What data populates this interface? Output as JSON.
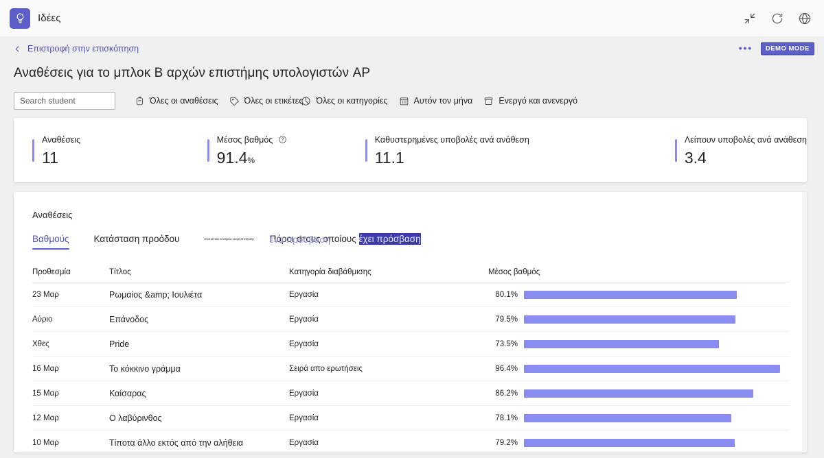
{
  "appbar": {
    "title": "Ιδέες",
    "logo_icon": "lightbulb-icon",
    "icons": [
      {
        "name": "collapse-icon",
        "label": "Collapse"
      },
      {
        "name": "refresh-icon",
        "label": "Refresh"
      },
      {
        "name": "globe-icon",
        "label": "Language"
      }
    ]
  },
  "breadcrumb": {
    "back_label": "Επιστροφή στην επισκόπηση",
    "more_label": "•••",
    "demo_badge": "DEMO MODE"
  },
  "page": {
    "title": "Αναθέσεις για το μπλοκ Β αρχών επιστήμης υπολογιστών AP"
  },
  "toolbar": {
    "search_placeholder": "Search student",
    "search_value": "",
    "filters": [
      {
        "label": "Όλες οι αναθέσεις",
        "icon": "backpack-icon"
      },
      {
        "label": "Όλες οι ετικέτες",
        "icon": "tag-icon"
      },
      {
        "label": "Όλες οι κατηγορίες",
        "icon": "pie-chart-icon"
      },
      {
        "label": "Αυτόν τον μήνα",
        "icon": "calendar-icon"
      },
      {
        "label": "Ενεργό και ανενεργό",
        "icon": "archive-icon"
      }
    ]
  },
  "stats": [
    {
      "label": "Αναθέσεις",
      "value": "11",
      "unit": "",
      "has_info": false
    },
    {
      "label": "Μέσος βαθμός",
      "value": "91.4",
      "unit": "%",
      "has_info": true
    },
    {
      "label": "Καθυστερημένες υποβολές ανά ανάθεση",
      "value": "11.1",
      "unit": "",
      "has_info": false
    },
    {
      "label": "Λείπουν υποβολές ανά ανάθεση",
      "value": "3.4",
      "unit": "",
      "has_info": false
    }
  ],
  "panel": {
    "title": "Αναθέσεις",
    "tabs": [
      {
        "label": "Βαθμούς",
        "active": true,
        "tiny": false
      },
      {
        "label": "Κατάσταση προόδου",
        "active": false,
        "tiny": false
      },
      {
        "label": "Στατιστικά στοιχεία ενεργοποίησης",
        "active": false,
        "tiny": true
      },
      {
        "label": "Πόροι στους οποίους ",
        "active": false,
        "tiny": false
      }
    ],
    "selected_text": "έχει πρόσβαση",
    "selected_overlay": "ένα πρόσβαση"
  },
  "table": {
    "columns": [
      "Προθεσμία",
      "Τίτλος",
      "Κατηγορία διαβάθμισης",
      "Μέσος βαθμός"
    ],
    "rows": [
      {
        "due": "23 Μαρ",
        "title": "Ρωμαίος &amp; Ιουλιέτα",
        "category": "Εργασία",
        "grade": "80.1%",
        "pct": 80.1
      },
      {
        "due": "Αύριο",
        "title": "Επάνοδος",
        "category": "Εργασία",
        "grade": "79.5%",
        "pct": 79.5
      },
      {
        "due": "Χθες",
        "title": "Pride",
        "category": "Εργασία",
        "grade": "73.5%",
        "pct": 73.5
      },
      {
        "due": "16 Μαρ",
        "title": "Το κόκκινο γράμμα",
        "category": "Σειρά απο ερωτήσεις",
        "grade": "96.4%",
        "pct": 96.4
      },
      {
        "due": "15 Μαρ",
        "title": "Καίσαρας",
        "category": "Εργασία",
        "grade": "86.2%",
        "pct": 86.2
      },
      {
        "due": "12 Μαρ",
        "title": "Ο λαβύρινθος",
        "category": "Εργασία",
        "grade": "78.1%",
        "pct": 78.1
      },
      {
        "due": "10 Μαρ",
        "title": "Τίποτα άλλο εκτός από την αλήθεια",
        "category": "Εργασία",
        "grade": "79.2%",
        "pct": 79.2
      }
    ]
  },
  "colors": {
    "accent": "#5b5fc7",
    "bar": "#8b8cf0",
    "link": "#4f52b2",
    "page_bg": "#f0f0f0"
  }
}
